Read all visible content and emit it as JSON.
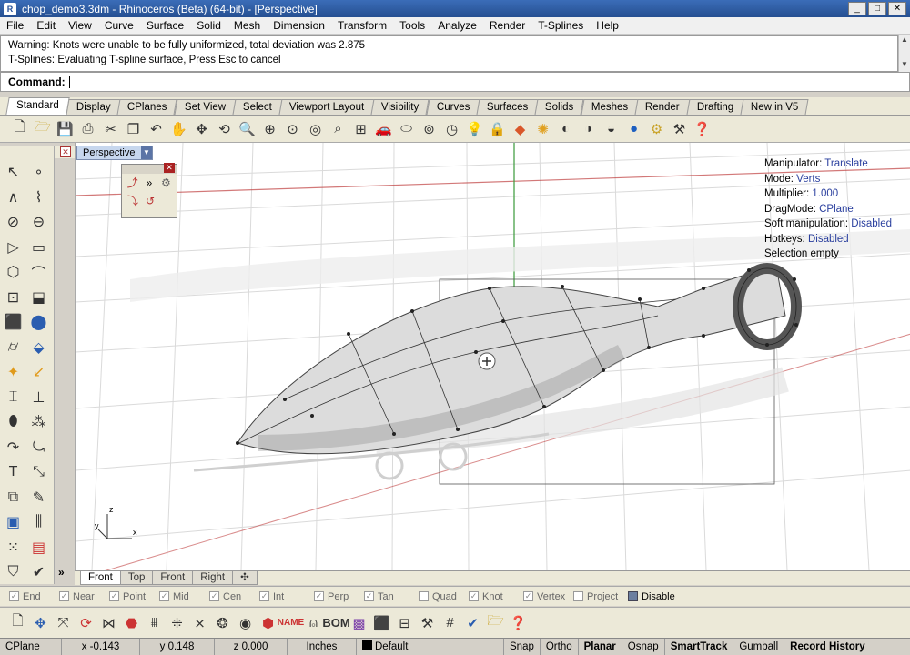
{
  "window": {
    "title": "chop_demo3.3dm - Rhinoceros (Beta) (64-bit) - [Perspective]"
  },
  "menu": [
    "File",
    "Edit",
    "View",
    "Curve",
    "Surface",
    "Solid",
    "Mesh",
    "Dimension",
    "Transform",
    "Tools",
    "Analyze",
    "Render",
    "T-Splines",
    "Help"
  ],
  "command_history": [
    "Warning: Knots were unable to be fully uniformized, total deviation was 2.875",
    "T-Splines: Evaluating T-spline surface, Press Esc to cancel"
  ],
  "command": {
    "label": "Command:",
    "value": ""
  },
  "toolbar_tabs": [
    "Standard",
    "Display",
    "CPlanes",
    "Set View",
    "Select",
    "Viewport Layout",
    "Visibility",
    "Curves",
    "Surfaces",
    "Solids",
    "Meshes",
    "Render",
    "Drafting",
    "New in V5"
  ],
  "active_toolbar_tab": "Standard",
  "viewport": {
    "name": "Perspective",
    "axis_labels": {
      "x": "x",
      "y": "y",
      "z": "z"
    },
    "overlay": [
      {
        "key": "Manipulator:",
        "value": "Translate"
      },
      {
        "key": "Mode:",
        "value": "Verts"
      },
      {
        "key": "Multiplier:",
        "value": "1.000"
      },
      {
        "key": "DragMode:",
        "value": "CPlane"
      },
      {
        "key": "Soft manipulation:",
        "value": "Disabled"
      },
      {
        "key": "Hotkeys:",
        "value": "Disabled"
      },
      {
        "key": "Selection empty",
        "value": ""
      }
    ]
  },
  "viewport_tabs": [
    "Front",
    "Top",
    "Front",
    "Right"
  ],
  "active_viewport_tab": "Front",
  "osnaps": [
    {
      "label": "End",
      "checked": true
    },
    {
      "label": "Near",
      "checked": true
    },
    {
      "label": "Point",
      "checked": true
    },
    {
      "label": "Mid",
      "checked": true
    },
    {
      "label": "Cen",
      "checked": true
    },
    {
      "label": "Int",
      "checked": true
    },
    {
      "label": "Perp",
      "checked": true
    },
    {
      "label": "Tan",
      "checked": true
    },
    {
      "label": "Quad",
      "checked": false
    },
    {
      "label": "Knot",
      "checked": true
    },
    {
      "label": "Vertex",
      "checked": true
    },
    {
      "label": "Project",
      "checked": false
    },
    {
      "label": "Disable",
      "checked": false
    }
  ],
  "status": {
    "cplane": "CPlane",
    "x": "x -0.143",
    "y": "y 0.148",
    "z": "z 0.000",
    "units": "Inches",
    "layer": "Default",
    "toggles": [
      "Snap",
      "Ortho",
      "Planar",
      "Osnap",
      "SmartTrack",
      "Gumball",
      "Record History"
    ]
  },
  "colors": {
    "title_bar": "#2d5ba3",
    "overlay_value": "#2a3f9e",
    "axis_red": "#c04040",
    "axis_green": "#3a9a3a",
    "grid": "#d8d8d8"
  }
}
